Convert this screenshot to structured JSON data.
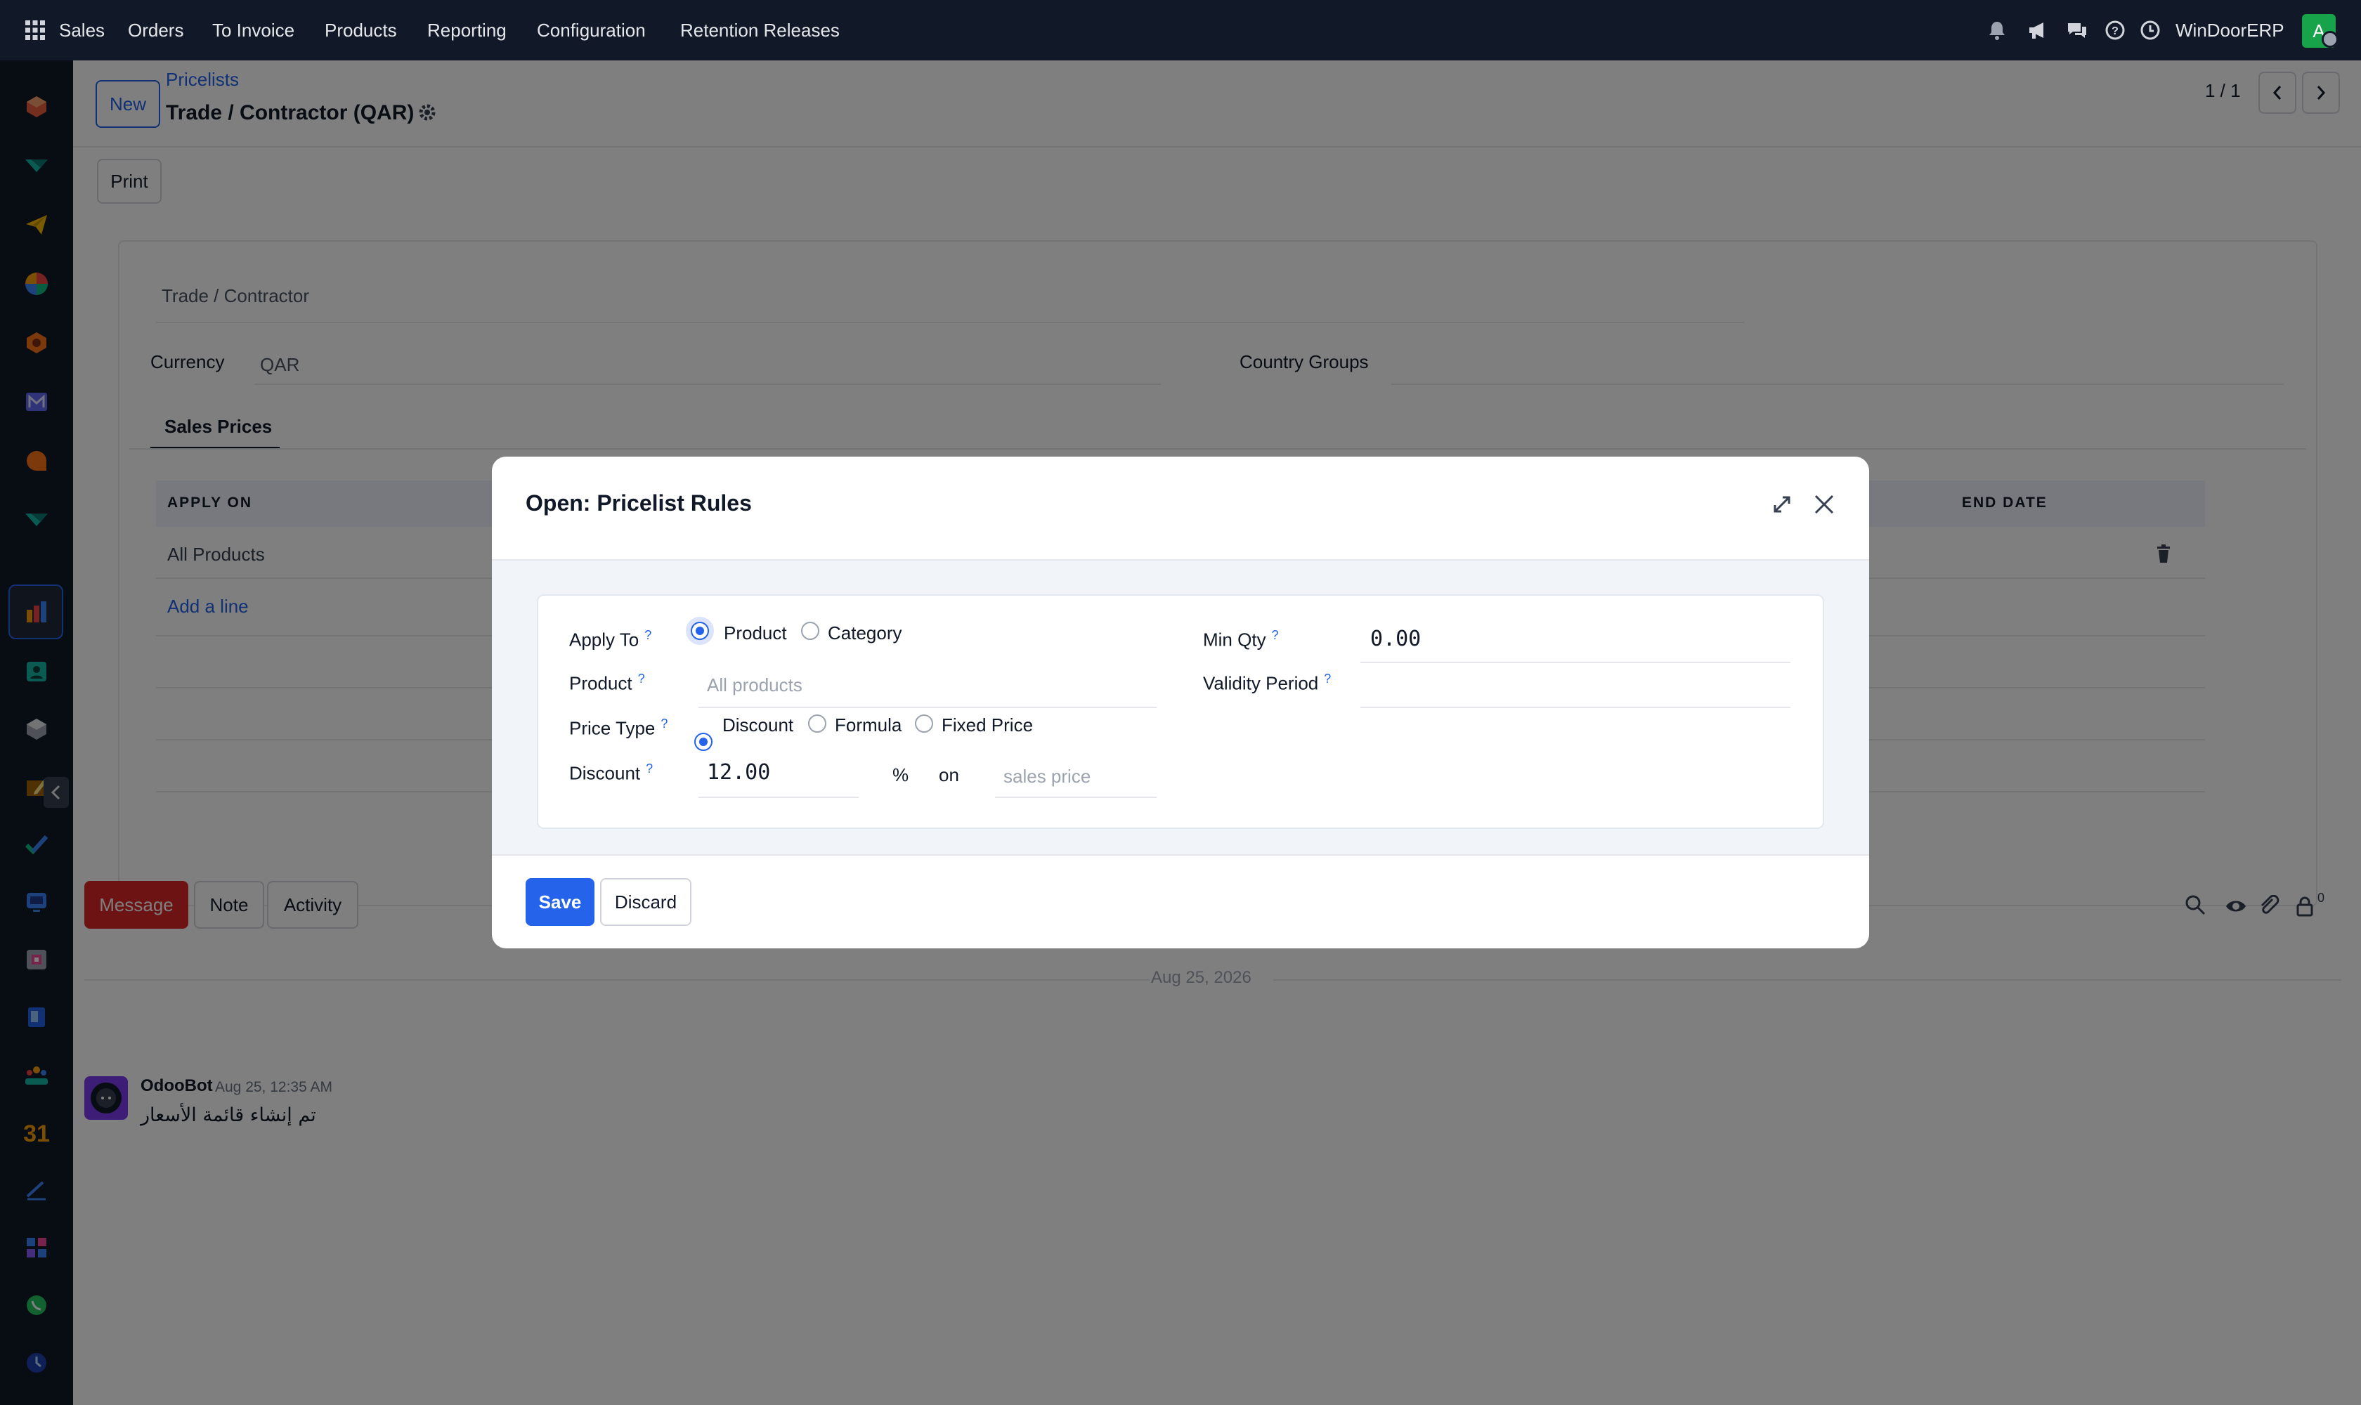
{
  "topbar": {
    "menu": [
      "Sales",
      "Orders",
      "To Invoice",
      "Products",
      "Reporting",
      "Configuration",
      "Retention Releases"
    ],
    "company": "WinDoorERP",
    "avatar_letter": "A"
  },
  "control": {
    "new_label": "New",
    "breadcrumb": "Pricelists",
    "record_title": "Trade / Contractor (QAR)",
    "pager": "1 / 1",
    "print_label": "Print"
  },
  "form": {
    "name": "Trade / Contractor",
    "currency_label": "Currency",
    "currency_value": "QAR",
    "country_groups_label": "Country Groups",
    "tab_label": "Sales Prices",
    "table_headers": {
      "apply_on": "APPLY ON",
      "end_date": "END DATE"
    },
    "row_apply_on": "All Products",
    "add_line": "Add a line"
  },
  "chatter": {
    "message_btn": "Message",
    "note_btn": "Note",
    "activity_btn": "Activity",
    "follower_count": "0",
    "date_separator": "Aug 25, 2026",
    "author": "OdooBot",
    "timestamp": "Aug 25, 12:35 AM",
    "body": "تم إنشاء قائمة الأسعار"
  },
  "dialog": {
    "title": "Open: Pricelist Rules",
    "apply_to_label": "Apply To",
    "apply_to_options": [
      "Product",
      "Category"
    ],
    "apply_to_selected": "Product",
    "product_label": "Product",
    "product_placeholder": "All products",
    "price_type_label": "Price Type",
    "price_type_options": [
      "Discount",
      "Formula",
      "Fixed Price"
    ],
    "price_type_selected": "Discount",
    "discount_label": "Discount",
    "discount_value": "12.00",
    "percent_symbol": "%",
    "on_text": "on",
    "base_placeholder": "sales price",
    "min_qty_label": "Min Qty",
    "min_qty_value": "0.00",
    "validity_label": "Validity Period",
    "help_mark": "?",
    "save_label": "Save",
    "discard_label": "Discard"
  },
  "colors": {
    "topbar_bg": "#111827",
    "primary": "#2563eb",
    "message_btn": "#dc2626",
    "table_header_bg": "#eef2ff"
  },
  "icons": {
    "sidebar": [
      "box-icon",
      "truck-icon",
      "paper-plane-icon",
      "pie-icon",
      "hexagon-icon",
      "mail-icon",
      "chat-bubble-icon",
      "truck-icon",
      "chart-icon",
      "contact-card-icon",
      "cube-icon",
      "pencil-icon",
      "check-icon",
      "monitor-icon",
      "package-icon",
      "book-icon",
      "team-icon",
      "calendar-icon",
      "sign-icon",
      "apps-icon",
      "whatsapp-icon",
      "clock-icon",
      "swirl-icon"
    ]
  }
}
